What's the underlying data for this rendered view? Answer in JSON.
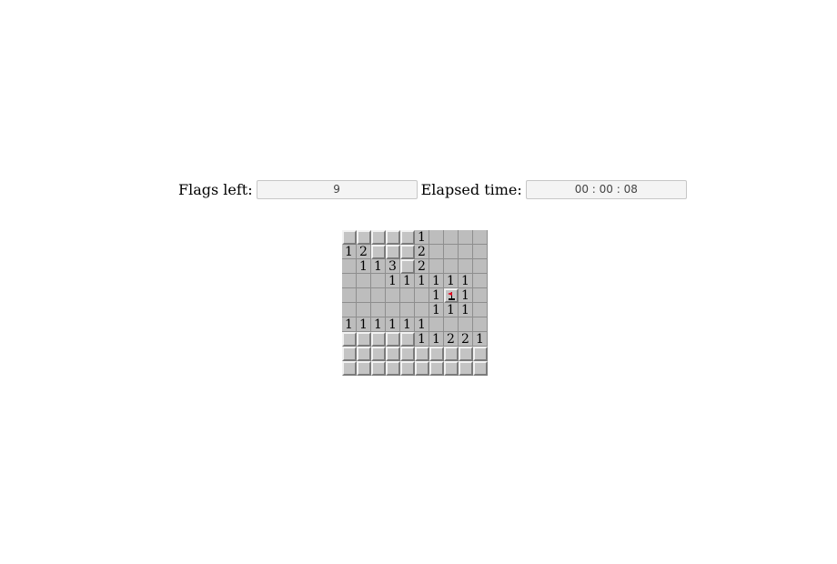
{
  "status": {
    "flags_label": "Flags left:",
    "flags_value": "9",
    "time_label": "Elapsed time:",
    "time_value": "00 : 00 : 08"
  },
  "board": {
    "rows": 10,
    "cols": 10,
    "legend": "H = unrevealed tile, F = flagged tile, 0 = empty revealed tile, 1-8 = revealed count",
    "cells": [
      [
        "H",
        "H",
        "H",
        "H",
        "H",
        "1",
        "0",
        "0",
        "0",
        "0"
      ],
      [
        "1",
        "2",
        "H",
        "H",
        "H",
        "2",
        "0",
        "0",
        "0",
        "0"
      ],
      [
        "0",
        "1",
        "1",
        "3",
        "H",
        "2",
        "0",
        "0",
        "0",
        "0"
      ],
      [
        "0",
        "0",
        "0",
        "1",
        "1",
        "1",
        "1",
        "1",
        "1",
        "0"
      ],
      [
        "0",
        "0",
        "0",
        "0",
        "0",
        "0",
        "1",
        "F",
        "1",
        "0"
      ],
      [
        "0",
        "0",
        "0",
        "0",
        "0",
        "0",
        "1",
        "1",
        "1",
        "0"
      ],
      [
        "1",
        "1",
        "1",
        "1",
        "1",
        "1",
        "0",
        "0",
        "0",
        "0"
      ],
      [
        "H",
        "H",
        "H",
        "H",
        "H",
        "1",
        "1",
        "2",
        "2",
        "1"
      ],
      [
        "H",
        "H",
        "H",
        "H",
        "H",
        "H",
        "H",
        "H",
        "H",
        "H"
      ],
      [
        "H",
        "H",
        "H",
        "H",
        "H",
        "H",
        "H",
        "H",
        "H",
        "H"
      ]
    ],
    "flag_icon": "flag-icon",
    "flag_color": "#e8001c"
  }
}
